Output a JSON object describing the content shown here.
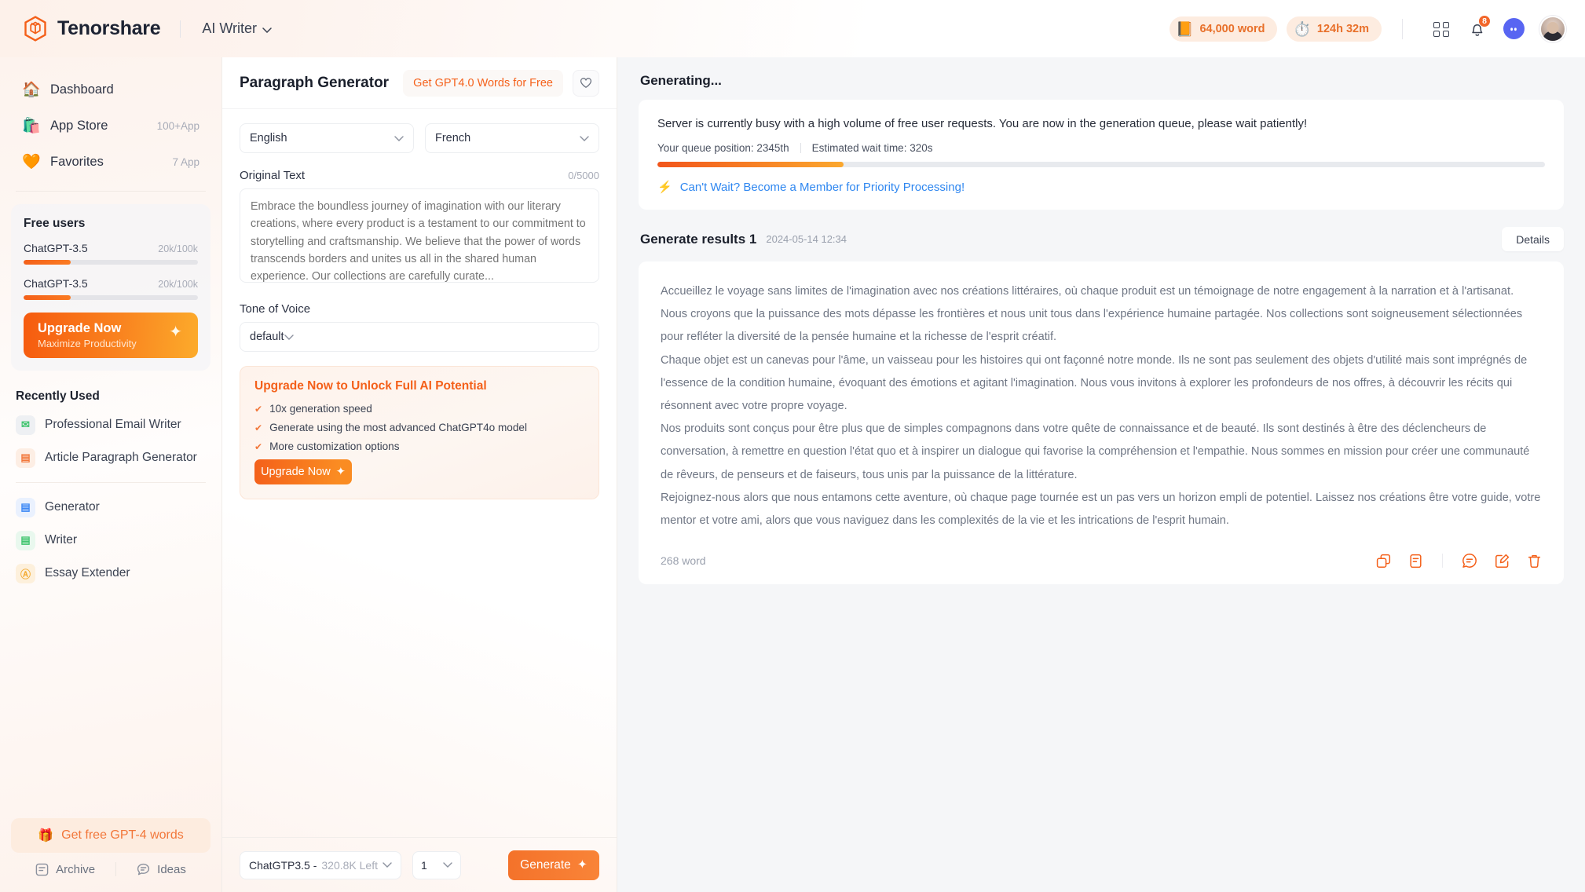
{
  "topbar": {
    "brand": "Tenorshare",
    "app_switch": "AI Writer",
    "word_pill": "64,000 word",
    "time_pill": "124h 32m",
    "notification_badge": "8",
    "icons": {
      "grid": "grid-icon",
      "bell": "bell-icon",
      "discord": "discord-icon",
      "avatar": "avatar"
    }
  },
  "sidebar": {
    "nav": [
      {
        "label": "Dashboard",
        "meta": "",
        "emoji": "🏠"
      },
      {
        "label": "App Store",
        "meta": "100+App",
        "emoji": "🛍️"
      },
      {
        "label": "Favorites",
        "meta": "7 App",
        "emoji": "🧡"
      }
    ],
    "usage": {
      "title": "Free users",
      "items": [
        {
          "name": "ChatGPT-3.5",
          "value": "20k/100k",
          "percent": 27
        },
        {
          "name": "ChatGPT-3.5",
          "value": "20k/100k",
          "percent": 27
        }
      ],
      "cta_title": "Upgrade Now",
      "cta_sub": "Maximize Productivity"
    },
    "recent_title": "Recently Used",
    "recent": [
      {
        "label": "Professional Email Writer",
        "color": "#3ec46d",
        "glyph": "✉",
        "bg": "#eef0f3"
      },
      {
        "label": "Article Paragraph Generator",
        "color": "#f2773a",
        "glyph": "▤",
        "bg": "#fdeee4"
      },
      {
        "label": "Generator",
        "color": "#3b87f5",
        "glyph": "▤",
        "bg": "#eaf1fe"
      },
      {
        "label": "Writer",
        "color": "#3ec46d",
        "glyph": "▤",
        "bg": "#e9f8ee"
      },
      {
        "label": "Essay Extender",
        "color": "#f4ad38",
        "glyph": "A",
        "bg": "#fdf0dc"
      }
    ],
    "free_words": "Get free GPT-4 words",
    "footer": [
      {
        "label": "Archive",
        "icon": "archive-icon"
      },
      {
        "label": "Ideas",
        "icon": "ideas-icon"
      }
    ]
  },
  "center": {
    "title": "Paragraph Generator",
    "gpt_free_button": "Get GPT4.0 Words for Free",
    "source_language": "English",
    "target_language": "French",
    "original_text_label": "Original Text",
    "char_counter": "0/5000",
    "original_text_placeholder": "Embrace the boundless journey of imagination with our literary creations, where every product is a testament to our commitment to storytelling and craftsmanship. We believe that the power of words transcends borders and unites us all in the shared human experience. Our collections are carefully curate...",
    "tone_label": "Tone of Voice",
    "tone_value": "default",
    "promo": {
      "title": "Upgrade Now to Unlock Full AI Potential",
      "bullets": [
        "10x generation speed",
        "Generate using the most advanced ChatGPT4o model",
        "More customization options"
      ],
      "button": "Upgrade Now"
    },
    "footer": {
      "model_name": "ChatGTP3.5 -",
      "model_left": "320.8K Left",
      "count": "1",
      "generate": "Generate"
    }
  },
  "main": {
    "generating_title": "Generating...",
    "queue": {
      "message": "Server is currently busy with a high volume of free user requests. You are now in the generation queue, please wait patiently!",
      "position": "Your queue position: 2345th",
      "wait": "Estimated wait time: 320s",
      "progress_percent": 21,
      "member_link": "Can't Wait? Become a Member for Priority Processing!"
    },
    "result": {
      "title": "Generate results 1",
      "timestamp": "2024-05-14 12:34",
      "details_button": "Details",
      "paragraphs": [
        "Accueillez le voyage sans limites de l'imagination avec nos créations littéraires, où chaque produit est un témoignage de notre engagement à la narration et à l'artisanat. Nous croyons que la puissance des mots dépasse les frontières et nous unit tous dans l'expérience humaine partagée. Nos collections sont soigneusement sélectionnées pour refléter la diversité de la pensée humaine et la richesse de l'esprit créatif.",
        "Chaque objet est un canevas pour l'âme, un vaisseau pour les histoires qui ont façonné notre monde. Ils ne sont pas seulement des objets d'utilité mais sont imprégnés de l'essence de la condition humaine, évoquant des émotions et agitant l'imagination. Nous vous invitons à explorer les profondeurs de nos offres, à découvrir les récits qui résonnent avec votre propre voyage.",
        "Nos produits sont conçus pour être plus que de simples compagnons dans votre quête de connaissance et de beauté. Ils sont destinés à être des déclencheurs de conversation, à remettre en question l'état quo et à inspirer un dialogue qui favorise la compréhension et l'empathie. Nous sommes en mission pour créer une communauté de rêveurs, de penseurs et de faiseurs, tous unis par la puissance de la littérature.",
        "Rejoignez-nous alors que nous entamons cette aventure, où chaque page tournée est un pas vers un horizon empli de potentiel. Laissez nos créations être votre guide, votre mentor et votre ami, alors que vous naviguez dans les complexités de la vie et les intrications de l'esprit humain."
      ],
      "word_count": "268 word",
      "actions": [
        "copy-icon",
        "summarize-icon",
        "comment-icon",
        "edit-icon",
        "delete-icon"
      ]
    }
  },
  "colors": {
    "accent": "#f4601a",
    "accent_light": "#fba82e",
    "link": "#2f87f0",
    "panel_bg": "#f5f6f8"
  }
}
